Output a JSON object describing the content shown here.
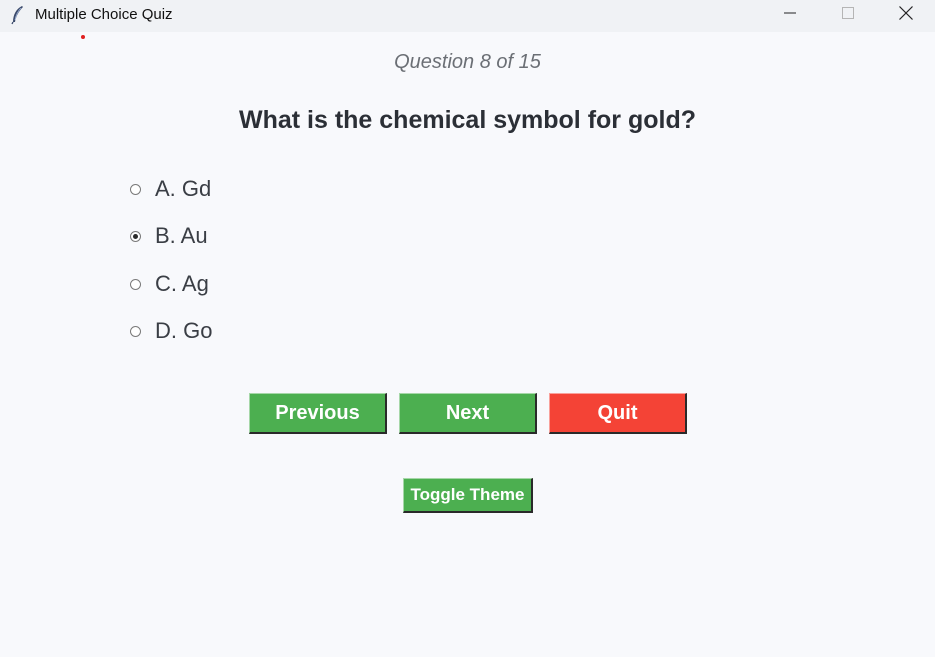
{
  "window": {
    "title": "Multiple Choice Quiz"
  },
  "quiz": {
    "progress": "Question 8 of 15",
    "question": "What is the chemical symbol for gold?",
    "options": [
      {
        "label": "A. Gd",
        "selected": false
      },
      {
        "label": "B. Au",
        "selected": true
      },
      {
        "label": "C. Ag",
        "selected": false
      },
      {
        "label": "D. Go",
        "selected": false
      }
    ]
  },
  "buttons": {
    "previous": "Previous",
    "next": "Next",
    "quit": "Quit",
    "toggle_theme": "Toggle Theme"
  },
  "colors": {
    "green": "#4caf50",
    "red": "#f44336",
    "background": "#f8f9fc"
  },
  "icons": {
    "app": "feather-icon",
    "minimize": "minimize-icon",
    "maximize": "maximize-icon",
    "close": "close-icon"
  }
}
